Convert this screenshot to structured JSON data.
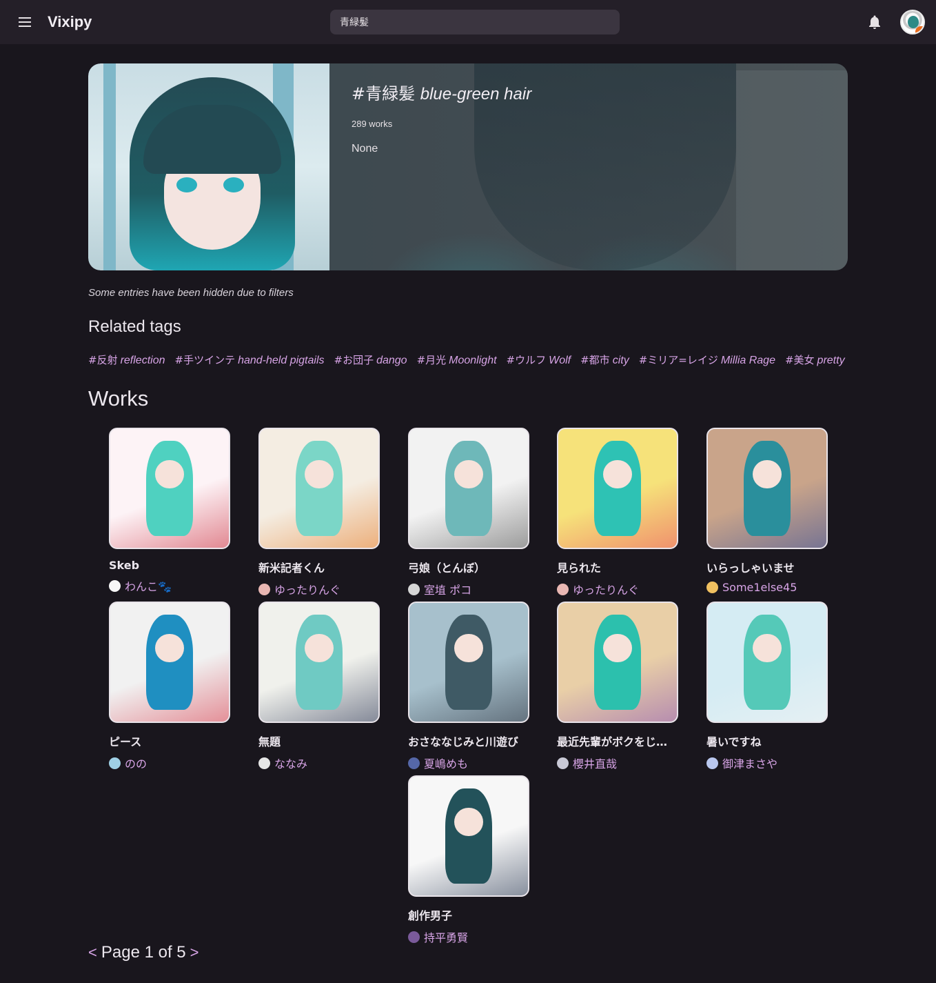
{
  "app": {
    "brand": "Vixipy",
    "search_value": "青緑髪"
  },
  "hero": {
    "tag_jp": "#青緑髪",
    "tag_en": "blue-green hair",
    "works_count": "289 works",
    "description": "None"
  },
  "filter_note": "Some entries have been hidden due to filters",
  "related": {
    "heading": "Related tags",
    "tags": [
      {
        "jp": "#反射",
        "en": "reflection"
      },
      {
        "jp": "#手ツインテ",
        "en": "hand-held pigtails"
      },
      {
        "jp": "#お団子",
        "en": "dango"
      },
      {
        "jp": "#月光",
        "en": "Moonlight"
      },
      {
        "jp": "#ウルフ",
        "en": "Wolf"
      },
      {
        "jp": "#都市",
        "en": "city"
      },
      {
        "jp": "#ミリア=レイジ",
        "en": "Millia Rage"
      },
      {
        "jp": "#美女",
        "en": "pretty woman"
      }
    ]
  },
  "works": {
    "heading": "Works",
    "items": [
      {
        "title": "Skeb",
        "author": "わんこ🐾",
        "colors": [
          "#fdf3f6",
          "#4fd1c0",
          "#c92a3a"
        ]
      },
      {
        "title": "新米記者くん",
        "author": "ゆったりんぐ",
        "colors": [
          "#f4ede2",
          "#7bd6c7",
          "#e67a23"
        ]
      },
      {
        "title": "弓娘（とんぼ）",
        "author": "室埴 ポコ",
        "colors": [
          "#f2f2f2",
          "#6eb8b9",
          "#505050"
        ]
      },
      {
        "title": "見られた",
        "author": "ゆったりんぐ",
        "colors": [
          "#f6e27a",
          "#2ec2b4",
          "#ea4a62"
        ]
      },
      {
        "title": "いらっしゃいませ",
        "author": "Some1else45",
        "colors": [
          "#c9a48a",
          "#2a8f9c",
          "#2f4a9a"
        ]
      },
      {
        "title": "ピース",
        "author": "のの",
        "colors": [
          "#f1f1f1",
          "#1f8fc1",
          "#d83a4a"
        ]
      },
      {
        "title": "無題",
        "author": "ななみ",
        "colors": [
          "#f0f1ec",
          "#6fcac3",
          "#273050"
        ]
      },
      {
        "title": "おさななじみと川遊び",
        "author": "夏嶋めも",
        "colors": [
          "#a7c0cc",
          "#3f5a65",
          "#2a2f3b"
        ]
      },
      {
        "title": "最近先輩がボクをじっと見てくる",
        "author": "櫻井直哉",
        "colors": [
          "#e9cfa7",
          "#2cc0ad",
          "#8a53b6"
        ]
      },
      {
        "title": "暑いですね",
        "author": "御津まさや",
        "colors": [
          "#d5ecf3",
          "#55c9b8",
          "#f3f3f3"
        ]
      },
      {
        "title": "創作男子",
        "author": "持平勇賢",
        "colors": [
          "#f7f7f7",
          "#23525a",
          "#25344f"
        ]
      }
    ],
    "author_avatar_colors": [
      "#f7f7f7",
      "#e9b7b3",
      "#d6d6d6",
      "#e9b7b3",
      "#f0c060",
      "#9fd0e6",
      "#e6e6e6",
      "#5567a8",
      "#c9c9d6",
      "#b9c7ee",
      "#7a5a9a"
    ]
  },
  "pager": {
    "prev": "<",
    "label": "Page 1 of 5",
    "next": ">"
  }
}
